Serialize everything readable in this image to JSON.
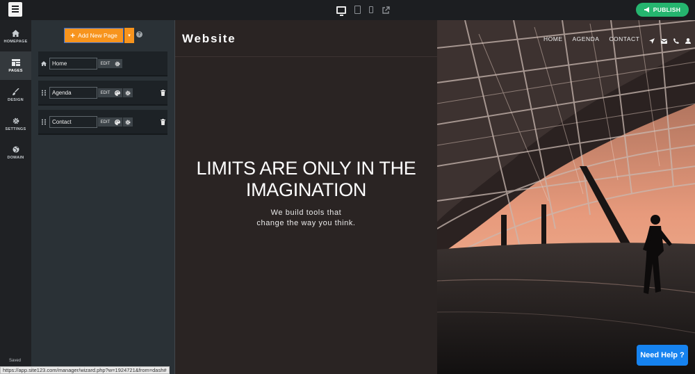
{
  "topbar": {
    "device_icons": [
      "desktop-icon",
      "tablet-icon",
      "mobile-icon",
      "external-link-icon"
    ],
    "publish_label": "PUBLISH"
  },
  "nav": {
    "items": [
      {
        "label": "HOMEPAGE",
        "icon": "home-icon"
      },
      {
        "label": "PAGES",
        "icon": "pages-icon"
      },
      {
        "label": "DESIGN",
        "icon": "brush-icon"
      },
      {
        "label": "SETTINGS",
        "icon": "gear-icon"
      },
      {
        "label": "DOMAIN",
        "icon": "globe-icon"
      }
    ],
    "saved_label": "Saved"
  },
  "pages_panel": {
    "add_label": "Add New Page",
    "edit_label": "EDIT",
    "pages": [
      {
        "name": "Home"
      },
      {
        "name": "Agenda"
      },
      {
        "name": "Contact"
      }
    ]
  },
  "preview": {
    "site_title": "Website",
    "nav_links": [
      "HOME",
      "AGENDA",
      "CONTACT"
    ],
    "social_icons": [
      "location-icon",
      "mail-icon",
      "phone-icon",
      "user-icon"
    ],
    "headline_line1": "LIMITS ARE ONLY IN THE",
    "headline_line2": "IMAGINATION",
    "sub_line1": "We build tools that",
    "sub_line2": "change the way you think."
  },
  "status_url": "https://app.site123.com/manager/wizard.php?w=1924721&from=dash#",
  "help_button": "Need Help ?",
  "colors": {
    "publish": "#25b56f",
    "add_button": "#f7941d",
    "help_button": "#1683f0",
    "preview_bg": "#2a2423"
  }
}
